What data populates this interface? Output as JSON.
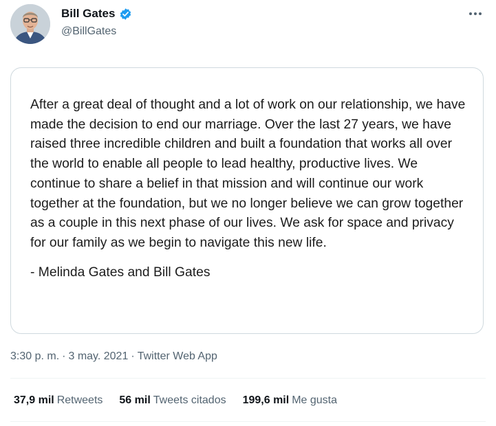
{
  "author": {
    "display_name": "Bill Gates",
    "handle": "@BillGates",
    "verified_icon": "verified-badge-icon",
    "avatar_icon": "avatar-photo"
  },
  "menu": {
    "icon": "more-options-icon"
  },
  "statement": {
    "text": "After a great deal of thought and a lot of work on our relationship, we have made the decision to end our marriage. Over the last 27 years, we have raised three incredible children and built a foundation that works all over the world to enable all people to lead healthy, productive lives. We continue to share a belief in that mission and will continue our work together at the foundation, but we no longer believe we can grow together as a couple in this next phase of our lives. We ask for space and privacy for our family as we begin to navigate this new life.",
    "signature": "- Melinda Gates and Bill Gates"
  },
  "meta": {
    "time": "3:30 p. m.",
    "sep1": "·",
    "date": "3 may. 2021",
    "sep2": "·",
    "source": "Twitter Web App"
  },
  "stats": {
    "retweets_count": "37,9 mil",
    "retweets_label": "Retweets",
    "quotes_count": "56 mil",
    "quotes_label": "Tweets citados",
    "likes_count": "199,6 mil",
    "likes_label": "Me gusta"
  },
  "colors": {
    "accent": "#1d9bf0",
    "text_primary": "#0f1419",
    "text_secondary": "#536471",
    "border": "#cfd9de"
  }
}
